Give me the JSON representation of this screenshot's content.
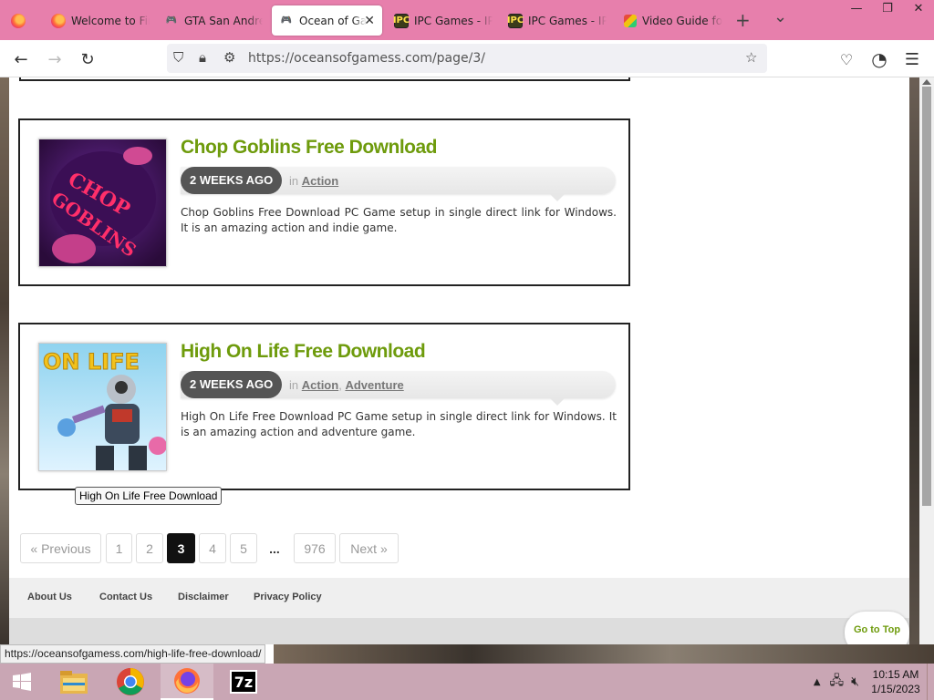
{
  "browser": {
    "tabs": [
      {
        "label": "",
        "icon": "firefox-icon"
      },
      {
        "label": "Welcome to Fir",
        "icon": "firefox-icon"
      },
      {
        "label": "GTA San Andre",
        "icon": "gamepad-icon"
      },
      {
        "label": "Ocean of Gam",
        "icon": "gamepad-icon",
        "active": true
      },
      {
        "label": "IPC Games - IP",
        "icon": "ipc-icon"
      },
      {
        "label": "IPC Games - IP",
        "icon": "ipc-icon"
      },
      {
        "label": "Video Guide fo",
        "icon": "cube-icon"
      }
    ],
    "new_tab": "+",
    "list_all_tabs": "⌄",
    "window_controls": {
      "minimize": "—",
      "maximize": "❐",
      "close": "✕"
    },
    "url": "https://oceansofgamess.com/page/3/"
  },
  "posts": [
    {
      "title": "Chop Goblins Free Download",
      "ago": "2 WEEKS AGO",
      "in": "in",
      "categories": [
        "Action"
      ],
      "excerpt": "Chop Goblins Free Download PC Game setup in single direct link for Windows. It is an amazing action and indie game."
    },
    {
      "title": "High On Life Free Download",
      "ago": "2 WEEKS AGO",
      "in": "in",
      "categories": [
        "Action",
        "Adventure"
      ],
      "excerpt": "High On Life Free Download PC Game setup in single direct link for Windows. It is an amazing action and adventure game."
    }
  ],
  "tooltip": "High On Life Free Download",
  "pagination": {
    "previous": "« Previous",
    "pages": [
      "1",
      "2",
      "3",
      "4",
      "5"
    ],
    "current": "3",
    "ellipsis": "...",
    "last": "976",
    "next": "Next »"
  },
  "footer": {
    "links": [
      "About Us",
      "Contact Us",
      "Disclaimer",
      "Privacy Policy"
    ],
    "go_to_top": "Go to Top"
  },
  "status_url": "https://oceansofgamess.com/high-life-free-download/",
  "taskbar": {
    "apps": [
      "start-icon",
      "file-explorer-icon",
      "chrome-icon",
      "firefox-icon",
      "7zip-icon"
    ],
    "time": "10:15 AM",
    "date": "1/15/2023"
  },
  "colors": {
    "tabbar": "#e77fac",
    "title_green": "#6e9b0c",
    "taskbar": "#c9a6b4"
  }
}
